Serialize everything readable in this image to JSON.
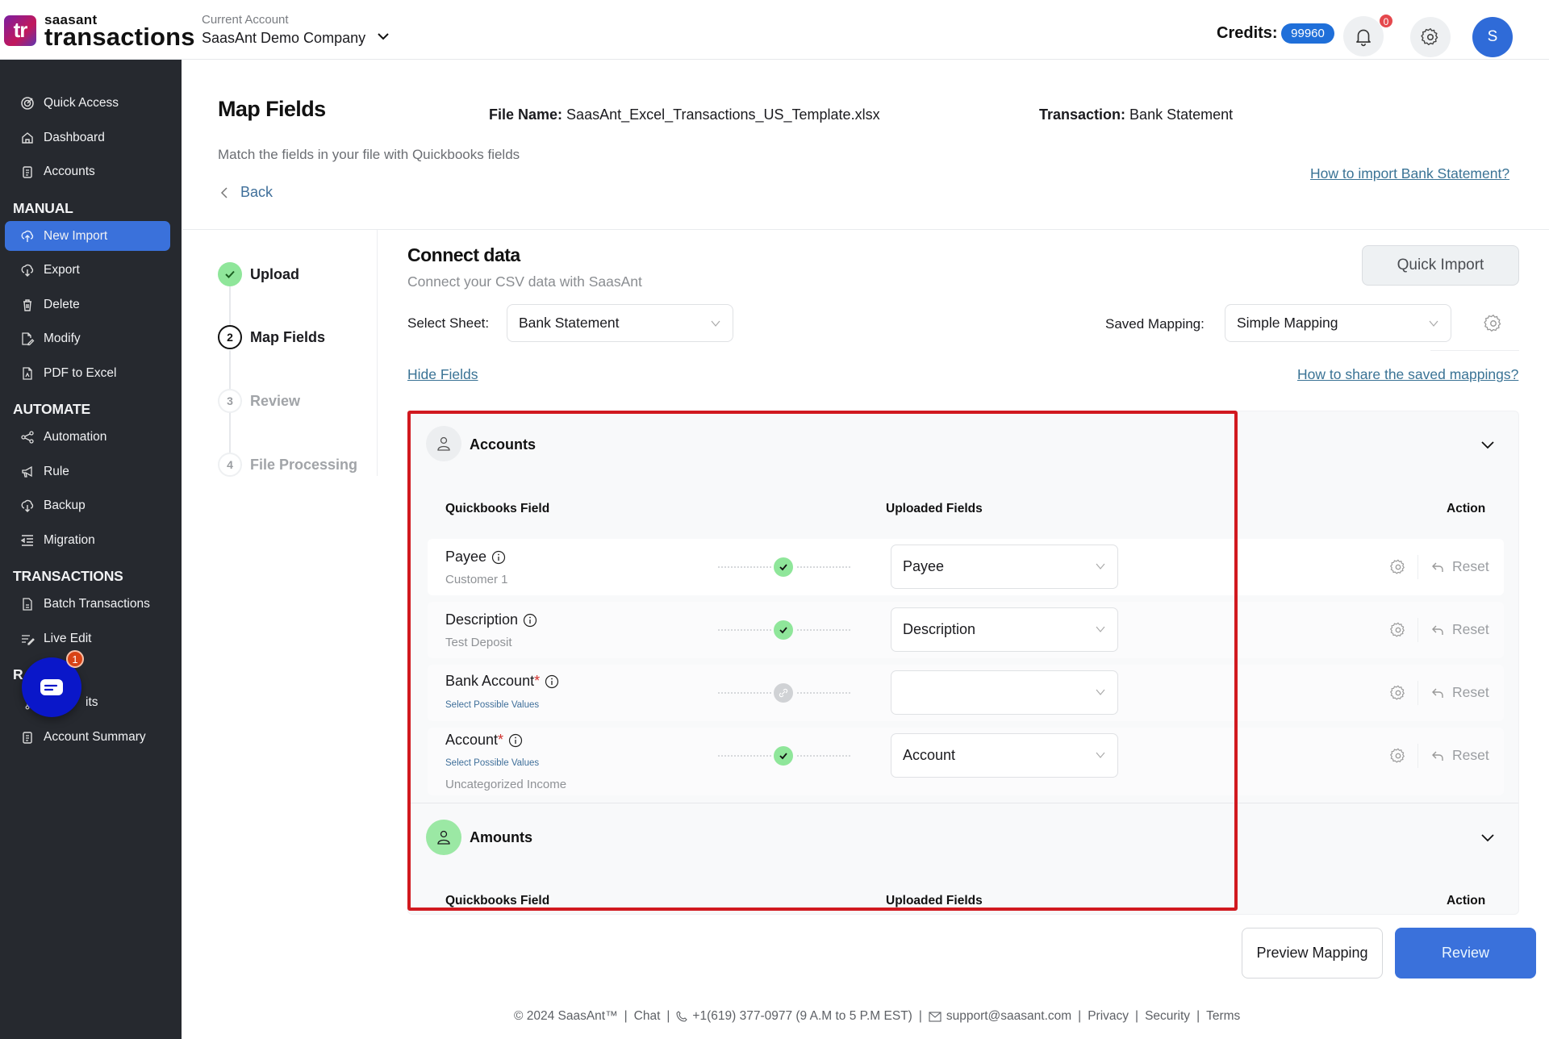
{
  "brand": {
    "logo_mark": "tr",
    "name_small": "saasant",
    "name_big": "transactions"
  },
  "topbar": {
    "account_label": "Current Account",
    "account_name": "SaasAnt Demo Company",
    "credits_label": "Credits:",
    "credits_value": "99960",
    "notifications_count": "0",
    "avatar_initial": "S"
  },
  "sidebar": {
    "items_top": [
      {
        "label": "Quick Access",
        "icon": "target-icon"
      },
      {
        "label": "Dashboard",
        "icon": "home-icon"
      },
      {
        "label": "Accounts",
        "icon": "clipboard-icon"
      }
    ],
    "sections": [
      {
        "title": "MANUAL",
        "items": [
          {
            "label": "New Import",
            "icon": "cloud-upload-icon",
            "active": true
          },
          {
            "label": "Export",
            "icon": "cloud-download-icon"
          },
          {
            "label": "Delete",
            "icon": "trash-icon"
          },
          {
            "label": "Modify",
            "icon": "file-edit-icon"
          },
          {
            "label": "PDF to Excel",
            "icon": "pdf-icon"
          }
        ]
      },
      {
        "title": "AUTOMATE",
        "items": [
          {
            "label": "Automation",
            "icon": "share-nodes-icon"
          },
          {
            "label": "Rule",
            "icon": "megaphone-icon"
          },
          {
            "label": "Backup",
            "icon": "cloud-download-icon"
          },
          {
            "label": "Migration",
            "icon": "list-indent-icon"
          }
        ]
      },
      {
        "title": "TRANSACTIONS",
        "items": [
          {
            "label": "Batch Transactions",
            "icon": "document-icon"
          },
          {
            "label": "Live Edit",
            "icon": "edit-lines-icon"
          }
        ]
      },
      {
        "title": "R",
        "items": [
          {
            "label": "its",
            "icon": "pin-icon"
          },
          {
            "label": "Account Summary",
            "icon": "clipboard-icon"
          }
        ]
      }
    ],
    "chat_badge": "1"
  },
  "header": {
    "title": "Map Fields",
    "file_name_label": "File Name:",
    "file_name": "SaasAnt_Excel_Transactions_US_Template.xlsx",
    "transaction_label": "Transaction:",
    "transaction": "Bank Statement",
    "subtitle": "Match the fields in your file with Quickbooks fields",
    "back_label": "Back",
    "howto_link": "How to import Bank Statement?"
  },
  "stepper": [
    {
      "number": "1",
      "label": "Upload",
      "state": "done"
    },
    {
      "number": "2",
      "label": "Map Fields",
      "state": "current"
    },
    {
      "number": "3",
      "label": "Review",
      "state": "pending"
    },
    {
      "number": "4",
      "label": "File Processing",
      "state": "pending"
    }
  ],
  "connect": {
    "title": "Connect data",
    "subtitle": "Connect your CSV data with SaasAnt",
    "quick_import": "Quick Import",
    "select_sheet_label": "Select Sheet:",
    "select_sheet_value": "Bank Statement",
    "saved_mapping_label": "Saved Mapping:",
    "saved_mapping_value": "Simple Mapping",
    "hide_fields": "Hide Fields",
    "share_link": "How to share the saved mappings?"
  },
  "groups": [
    {
      "title": "Accounts",
      "columns": {
        "qb": "Quickbooks Field",
        "uploaded": "Uploaded Fields",
        "action": "Action"
      },
      "rows": [
        {
          "name": "Payee",
          "required": false,
          "sub": "Customer 1",
          "link": "",
          "status": "mapped",
          "value": "Payee",
          "reset": "Reset"
        },
        {
          "name": "Description",
          "required": false,
          "sub": "Test Deposit",
          "link": "",
          "status": "mapped",
          "value": "Description",
          "reset": "Reset"
        },
        {
          "name": "Bank Account",
          "required": true,
          "sub": "",
          "link": "Select Possible Values",
          "status": "unmapped",
          "value": "",
          "reset": "Reset"
        },
        {
          "name": "Account",
          "required": true,
          "sub": "Uncategorized Income",
          "link": "Select Possible Values",
          "status": "mapped",
          "value": "Account",
          "reset": "Reset"
        }
      ]
    },
    {
      "title": "Amounts",
      "columns": {
        "qb": "Quickbooks Field",
        "uploaded": "Uploaded Fields",
        "action": "Action"
      },
      "rows": []
    }
  ],
  "actions": {
    "preview": "Preview Mapping",
    "review": "Review"
  },
  "footer": {
    "copyright": "© 2024 SaasAnt™",
    "chat": "Chat",
    "phone": "+1(619) 377-0977 (9 A.M to 5 P.M EST)",
    "email": "support@saasant.com",
    "privacy": "Privacy",
    "security": "Security",
    "terms": "Terms"
  },
  "colors": {
    "primary": "#3a71db",
    "sidebar_bg": "#26292f",
    "success": "#8fe69a",
    "highlight_box": "#d1191f",
    "link": "#3a7395"
  }
}
